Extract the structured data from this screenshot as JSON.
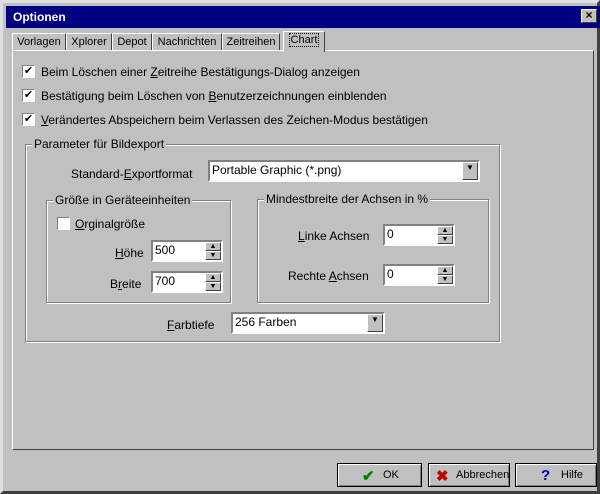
{
  "window": {
    "title": "Optionen",
    "close": "×"
  },
  "tabs": [
    "Vorlagen",
    "Xplorer",
    "Depot",
    "Nachrichten",
    "Zeitreihen",
    "Chart"
  ],
  "checkboxes": [
    {
      "pre": "Beim Löschen einer ",
      "ul": "Z",
      "post": "eitreihe Bestätigungs-Dialog anzeigen",
      "checked": true
    },
    {
      "pre": "Bestätigung beim Löschen von ",
      "ul": "B",
      "post": "enutzerzeichnungen einblenden",
      "checked": true
    },
    {
      "pre": "",
      "ul": "V",
      "post": "erändertes Abspeichern beim Verlassen des Zeichen-Modus bestätigen",
      "checked": true
    }
  ],
  "export": {
    "group_title": "Parameter für Bildexport",
    "format_label_pre": "Standard-",
    "format_label_ul": "E",
    "format_label_post": "xportformat",
    "format_value": "Portable Graphic (*.png)",
    "size_group": "Größe in Geräteeinheiten",
    "orig_pre": "",
    "orig_ul": "O",
    "orig_post": "rginalgröße",
    "orig_checked": false,
    "height_ul": "H",
    "height_post": "öhe",
    "height_value": "500",
    "width_pre": "B",
    "width_ul": "r",
    "width_post": "eite",
    "width_value": "700",
    "axis_group": "Mindestbreite der Achsen in %",
    "left_ul": "L",
    "left_post": "inke Achsen",
    "left_value": "0",
    "right_pre": "Rechte ",
    "right_ul": "A",
    "right_post": "chsen",
    "right_value": "0",
    "depth_ul": "F",
    "depth_post": "arbtiefe",
    "depth_value": "256 Farben"
  },
  "buttons": {
    "ok": "OK",
    "cancel": "Abbrechen",
    "help": "Hilfe"
  },
  "icons": {
    "ok": "check-icon",
    "cancel": "x-icon",
    "help": "question-icon"
  },
  "colors": {
    "titlebar": "#000080",
    "face": "#c0c0c0",
    "ok_icon": "#008000",
    "cancel_icon": "#c00000",
    "help_icon": "#0000c0"
  }
}
